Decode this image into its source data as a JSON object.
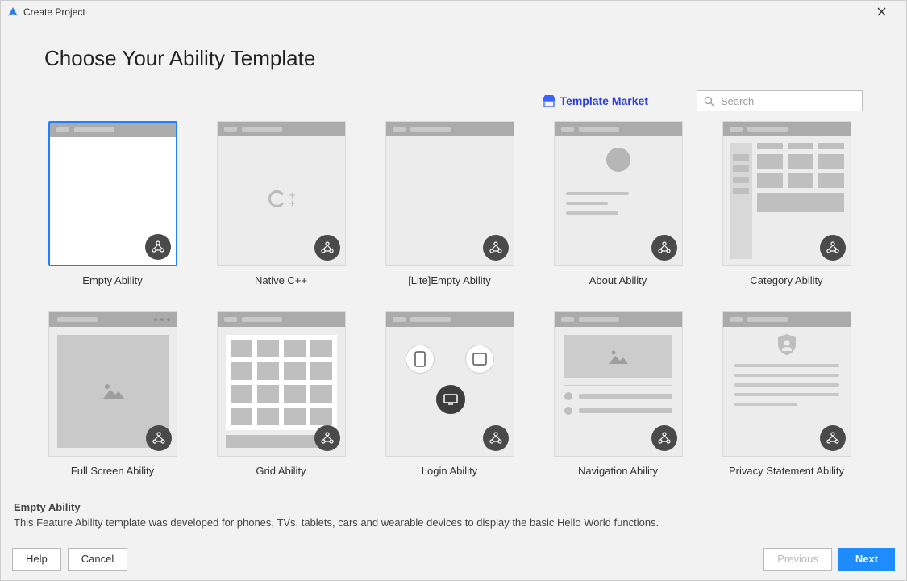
{
  "window": {
    "title": "Create Project"
  },
  "page_title": "Choose Your Ability Template",
  "toolbar": {
    "market_link": "Template Market",
    "search_placeholder": "Search"
  },
  "templates": [
    {
      "label": "Empty Ability",
      "selected": true
    },
    {
      "label": "Native C++"
    },
    {
      "label": "[Lite]Empty Ability"
    },
    {
      "label": "About Ability"
    },
    {
      "label": "Category Ability"
    },
    {
      "label": "Full Screen Ability"
    },
    {
      "label": "Grid Ability"
    },
    {
      "label": "Login Ability"
    },
    {
      "label": "Navigation Ability"
    },
    {
      "label": "Privacy Statement Ability"
    }
  ],
  "description": {
    "title": "Empty Ability",
    "body": "This Feature Ability template was developed for phones, TVs, tablets, cars and wearable devices to display the basic Hello World functions."
  },
  "footer": {
    "help": "Help",
    "cancel": "Cancel",
    "previous": "Previous",
    "next": "Next"
  },
  "colors": {
    "accent": "#1e8bff",
    "link": "#2b3de0"
  }
}
